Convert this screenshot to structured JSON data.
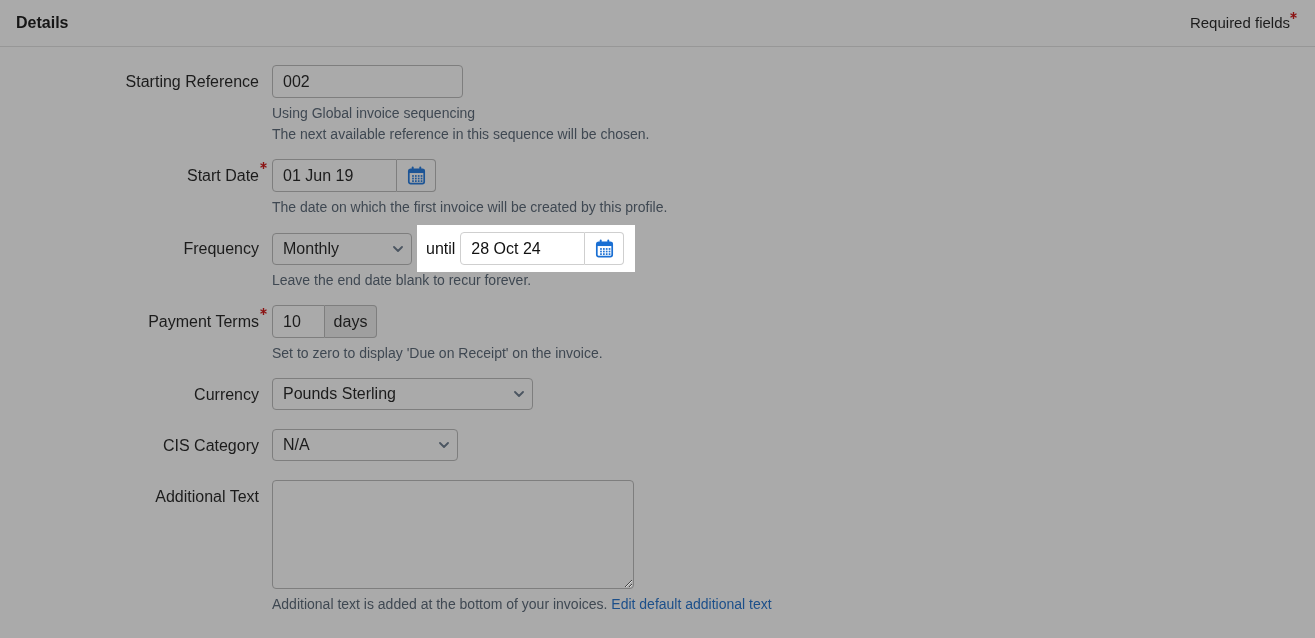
{
  "header": {
    "title": "Details",
    "required_note": "Required fields",
    "marked": true
  },
  "fields": [
    {
      "kind": "text",
      "label": "Starting Reference",
      "required": false,
      "value": "002",
      "help": [
        "Using Global invoice sequencing",
        "The next available reference in this sequence will be chosen."
      ]
    },
    {
      "kind": "date",
      "label": "Start Date",
      "required": true,
      "value": "01 Jun 19",
      "help": [
        "The date on which the first invoice will be created by this profile."
      ]
    },
    {
      "kind": "frequency",
      "label": "Frequency",
      "required": false,
      "value": "Monthly",
      "until": {
        "label": "until",
        "value": "28 Oct 24",
        "highlighted": true
      },
      "help": [
        "Leave the end date blank to recur forever."
      ]
    },
    {
      "kind": "addon",
      "label": "Payment Terms",
      "required": true,
      "value": "10",
      "addon": "days",
      "help": [
        "Set to zero to display 'Due on Receipt' on the invoice."
      ]
    },
    {
      "kind": "select",
      "label": "Currency",
      "required": false,
      "value": "Pounds Sterling"
    },
    {
      "kind": "select",
      "label": "CIS Category",
      "required": false,
      "value": "N/A"
    },
    {
      "kind": "textarea",
      "label": "Additional Text",
      "required": false,
      "help": [
        "Additional text is added at the bottom of your invoices."
      ],
      "help_link": "Edit default additional text"
    }
  ]
}
